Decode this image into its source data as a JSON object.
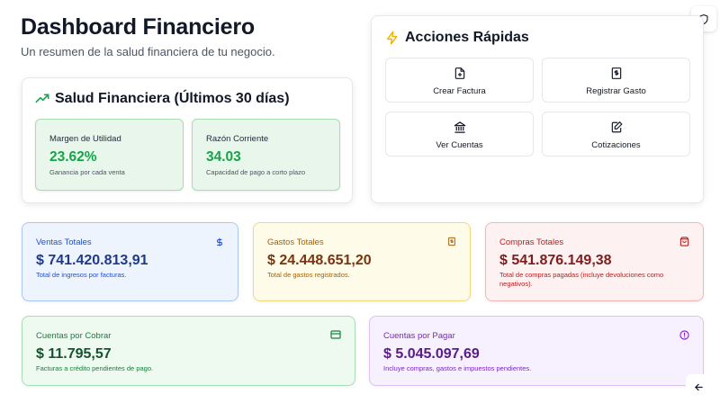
{
  "header": {
    "title": "Dashboard Financiero",
    "subtitle": "Un resumen de la salud financiera de tu negocio."
  },
  "health": {
    "title": "Salud Financiera (Últimos 30 días)",
    "icon": "trending-up-icon",
    "metrics": [
      {
        "label": "Margen de Utilidad",
        "value": "23.62%",
        "hint": "Ganancia por cada venta"
      },
      {
        "label": "Razón Corriente",
        "value": "34.03",
        "hint": "Capacidad de pago a corto plazo"
      }
    ]
  },
  "quick_actions": {
    "title": "Acciones Rápidas",
    "icon": "lightning-icon",
    "items": [
      {
        "label": "Crear Factura",
        "icon": "file-plus-icon"
      },
      {
        "label": "Registrar Gasto",
        "icon": "receipt-icon"
      },
      {
        "label": "Ver Cuentas",
        "icon": "bank-icon"
      },
      {
        "label": "Cotizaciones",
        "icon": "edit-document-icon"
      }
    ]
  },
  "stats": {
    "ventas": {
      "label": "Ventas Totales",
      "value": "$ 741.420.813,91",
      "hint": "Total de ingresos por facturas.",
      "icon": "dollar-icon"
    },
    "gastos": {
      "label": "Gastos Totales",
      "value": "$ 24.448.651,20",
      "hint": "Total de gastos registrados.",
      "icon": "receipt-icon"
    },
    "compras": {
      "label": "Compras Totales",
      "value": "$ 541.876.149,38",
      "hint": "Total de compras pagadas (incluye devoluciones como negativos).",
      "icon": "shopping-bag-icon"
    },
    "cobrar": {
      "label": "Cuentas por Cobrar",
      "value": "$ 11.795,57",
      "hint": "Facturas a crédito pendientes de pago.",
      "icon": "credit-card-icon"
    },
    "pagar": {
      "label": "Cuentas por Pagar",
      "value": "$ 5.045.097,69",
      "hint": "Incluye compras, gastos e impuestos pendientes.",
      "icon": "alert-circle-icon"
    }
  },
  "colors": {
    "accent_green": "#16a34a",
    "lightning": "#f5b400",
    "ventas": "#1d4ed8",
    "gastos": "#a16207",
    "compras": "#b91c1c",
    "cobrar": "#15803d",
    "pagar": "#7e22ce"
  }
}
